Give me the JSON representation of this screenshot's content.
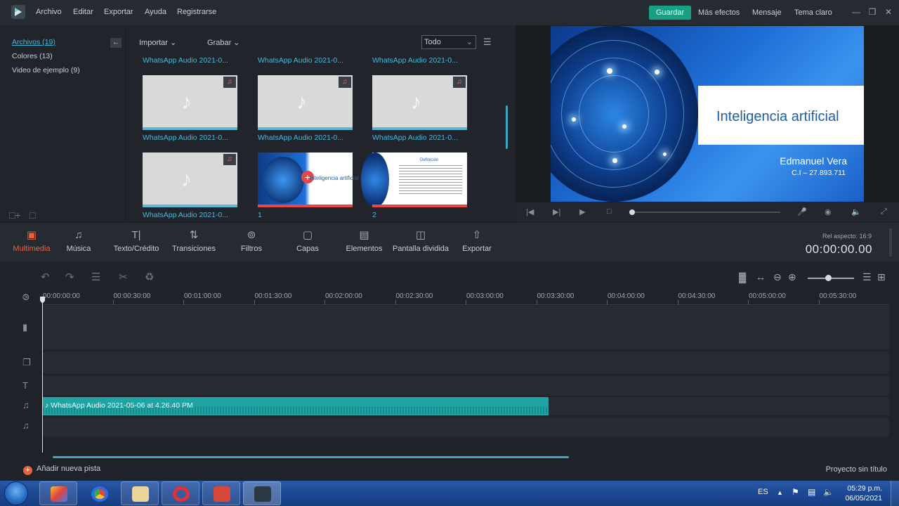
{
  "titlebar": {
    "menus": [
      "Archivo",
      "Editar",
      "Exportar",
      "Ayuda",
      "Registrarse"
    ],
    "save": "Guardar",
    "right": [
      "Más efectos",
      "Mensaje",
      "Tema claro"
    ]
  },
  "library": {
    "categories": [
      "Archivos (19)",
      "Colores (13)",
      "Video de ejemplo (9)"
    ]
  },
  "media": {
    "import": "Importar",
    "record": "Grabar",
    "filter": "Todo",
    "items": [
      {
        "label": "WhatsApp Audio 2021-0...",
        "kind": "audio"
      },
      {
        "label": "WhatsApp Audio 2021-0...",
        "kind": "audio"
      },
      {
        "label": "WhatsApp Audio 2021-0...",
        "kind": "audio"
      },
      {
        "label": "WhatsApp Audio 2021-0...",
        "kind": "audio"
      },
      {
        "label": "WhatsApp Audio 2021-0...",
        "kind": "audio"
      },
      {
        "label": "WhatsApp Audio 2021-0...",
        "kind": "audio"
      },
      {
        "label": "WhatsApp Audio 2021-0...",
        "kind": "audio"
      },
      {
        "label": "1",
        "kind": "slide"
      },
      {
        "label": "2",
        "kind": "slide2"
      }
    ],
    "slide2_heading": "Definición"
  },
  "preview": {
    "title": "Inteligencia artificial",
    "author": "Edmanuel Vera",
    "id": "C.I – 27.893.711"
  },
  "toolbar": {
    "tools": [
      "Multimedia",
      "Música",
      "Texto/Crédito",
      "Transiciones",
      "Filtros",
      "Capas",
      "Elementos",
      "Pantalla dividida",
      "Exportar"
    ],
    "aspect": "Rel aspecto: 16:9",
    "timecode": "00:00:00.00"
  },
  "timeline": {
    "ticks": [
      "00:00:00:00",
      "00:00:30:00",
      "00:01:00:00",
      "00:01:30:00",
      "00:02:00:00",
      "00:02:30:00",
      "00:03:00:00",
      "00:03:30:00",
      "00:04:00:00",
      "00:04:30:00",
      "00:05:00:00",
      "00:05:30:00"
    ],
    "clip": "WhatsApp Audio 2021-05-06 at 4.26.40 PM",
    "add_track": "Añadir nueva pista",
    "project": "Proyecto sin título"
  },
  "taskbar": {
    "lang": "ES",
    "time": "05:29 p.m.",
    "date": "06/05/2021"
  },
  "colors": {
    "accent": "#18a085",
    "active_tool": "#e5633f",
    "label_blue": "#49b7d9",
    "clip": "#1fa3a3"
  }
}
